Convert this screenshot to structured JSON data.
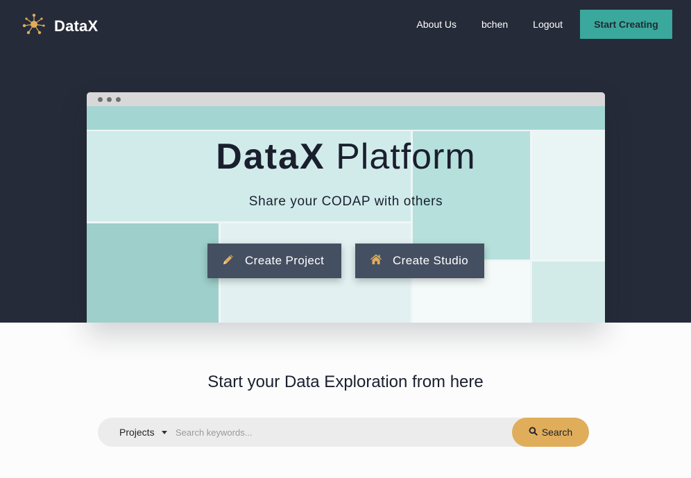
{
  "brand": {
    "name": "DataX",
    "logo_icon": "network-nodes-icon",
    "accent": "#e0ad5a"
  },
  "nav": {
    "links": [
      "About Us",
      "bchen",
      "Logout"
    ],
    "cta_label": "Start Creating",
    "cta_color": "#3aa89c"
  },
  "hero": {
    "title_bold": "DataX",
    "title_light": "Platform",
    "subtitle": "Share your CODAP with others",
    "buttons": [
      {
        "label": "Create Project",
        "icon": "pencil-icon"
      },
      {
        "label": "Create Studio",
        "icon": "home-icon"
      }
    ],
    "background": "#262b39"
  },
  "search_section": {
    "title": "Start your Data Exploration from here",
    "type_selected": "Projects",
    "placeholder": "Search keywords...",
    "button_label": "Search",
    "button_icon": "search-icon"
  }
}
